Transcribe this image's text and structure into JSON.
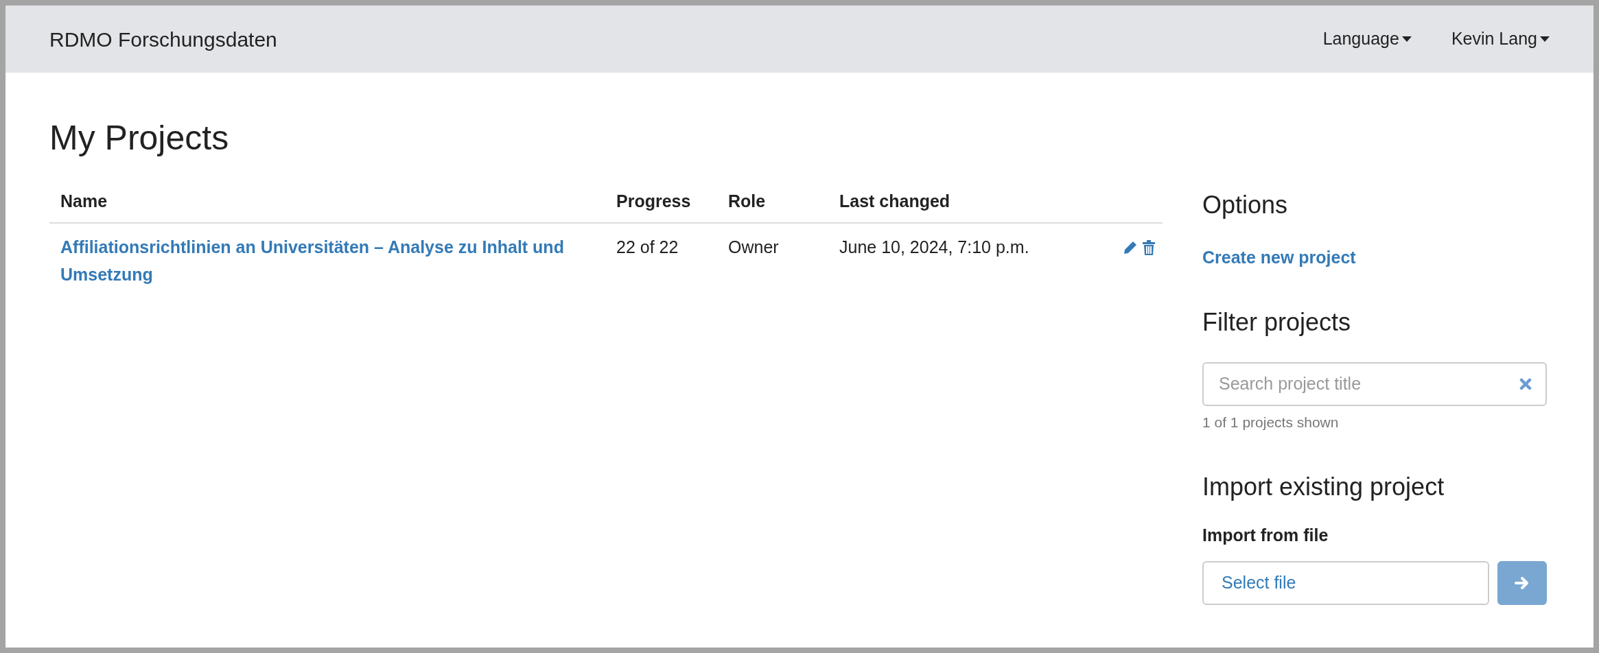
{
  "navbar": {
    "brand": "RDMO Forschungsdaten",
    "menus": [
      {
        "label": "Language"
      },
      {
        "label": "Kevin Lang"
      }
    ]
  },
  "heading": "My Projects",
  "table": {
    "columns": [
      "Name",
      "Progress",
      "Role",
      "Last changed"
    ],
    "rows": [
      {
        "name": "Affiliationsrichtlinien an Universitäten – Analyse zu Inhalt und Umsetzung",
        "progress": "22 of 22",
        "role": "Owner",
        "last_changed": "June 10, 2024, 7:10 p.m."
      }
    ]
  },
  "options": {
    "title": "Options",
    "link": "Create new project"
  },
  "filter": {
    "title": "Filter projects",
    "placeholder": "Search project title",
    "count": "1 of 1 projects shown"
  },
  "import": {
    "title": "Import existing project",
    "label": "Import from file",
    "file_button": "Select file",
    "submit_disabled": true
  }
}
